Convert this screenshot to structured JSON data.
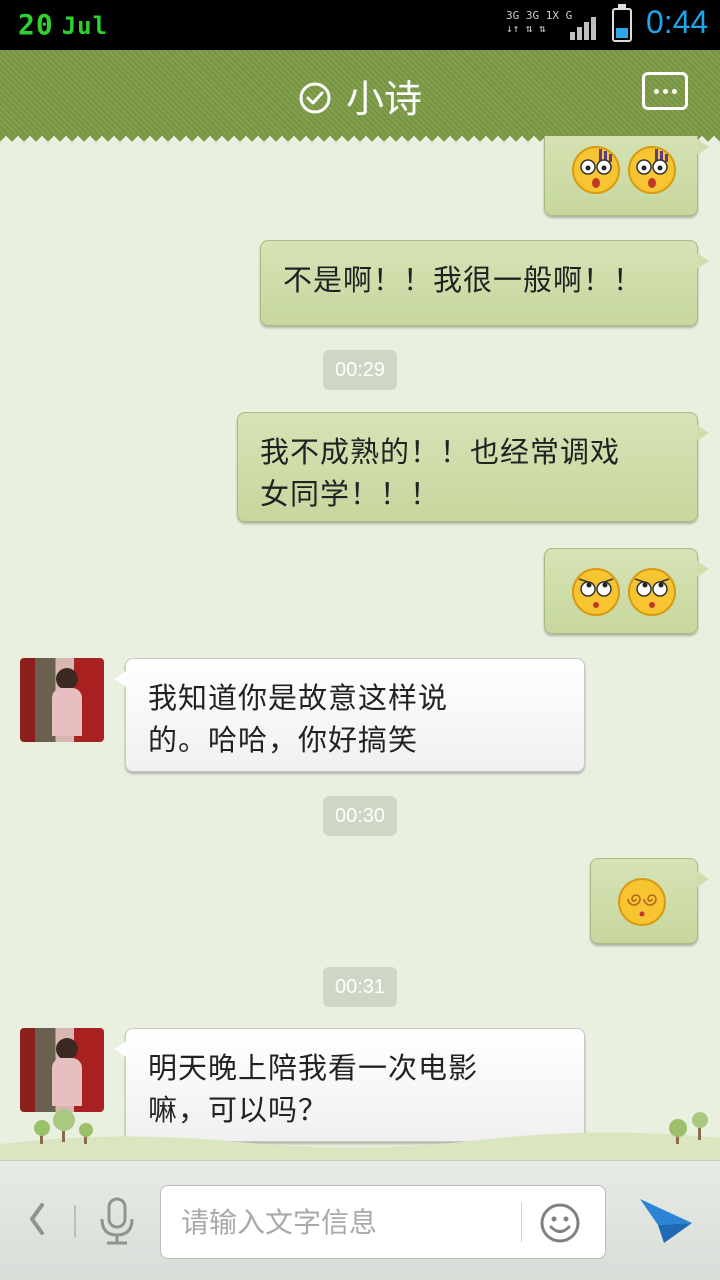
{
  "status_bar": {
    "day": "20",
    "month": "Jul",
    "network_line1": "3G 3G 1X G",
    "network_line2": "↓↑ ⇅ ⇅",
    "time": "0:44",
    "battery_level": 0.35
  },
  "header": {
    "title": "小诗",
    "more_icon": "more-dots-icon",
    "status_icon": "check-circle-icon"
  },
  "messages": [
    {
      "side": "out",
      "kind": "emoji",
      "emojis": [
        "shocked-face-emoji",
        "shocked-face-emoji"
      ]
    },
    {
      "side": "out",
      "kind": "text",
      "text": "不是啊！！我很一般啊！！"
    },
    {
      "kind": "time",
      "text": "00:29"
    },
    {
      "side": "out",
      "kind": "text",
      "line1": "我不成熟的！！也经常调戏",
      "line2": "女同学！！！"
    },
    {
      "side": "out",
      "kind": "emoji",
      "emojis": [
        "eye-roll-emoji",
        "eye-roll-emoji"
      ]
    },
    {
      "side": "in",
      "kind": "text",
      "line1": "我知道你是故意这样说",
      "line2": "的。哈哈，你好搞笑"
    },
    {
      "kind": "time",
      "text": "00:30"
    },
    {
      "side": "out",
      "kind": "emoji",
      "emojis": [
        "dizzy-face-emoji"
      ]
    },
    {
      "kind": "time",
      "text": "00:31"
    },
    {
      "side": "in",
      "kind": "text",
      "line1": "明天晚上陪我看一次电影",
      "line2": "嘛，可以吗？"
    }
  ],
  "input_bar": {
    "placeholder": "请输入文字信息",
    "value": ""
  },
  "colors": {
    "header": "#7c9a46",
    "outgoing_bubble": "#cfdeaa",
    "incoming_bubble": "#ffffff",
    "time_pill": "#cfd6c5",
    "send_accent": "#2b84d6"
  }
}
